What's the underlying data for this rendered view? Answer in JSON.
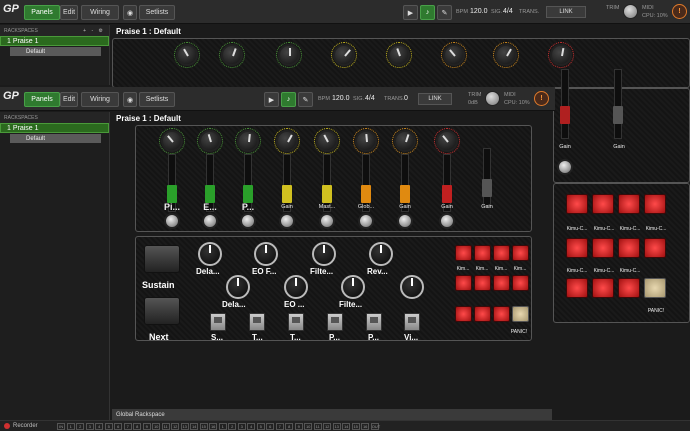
{
  "toolbar": {
    "logo": "GP",
    "tabs": {
      "panels": "Panels",
      "edit": "Edit",
      "wiring": "Wiring",
      "setlists": "Setlists"
    },
    "bpm_label": "BPM",
    "bpm_value": "120.0",
    "sig_label": "SIG.",
    "sig_value": "4/4",
    "trans_label": "TRANS.",
    "trans_value": "0",
    "link_label": "LINK",
    "trim_label": "TRIM",
    "trim_sub": "0dB",
    "midi_label": "MIDI",
    "cpu_label": "CPU:",
    "cpu_value": "10%",
    "panic_symbol": "!"
  },
  "sidebar": {
    "header": "RACKSPACES",
    "controls": "+ - ⚙",
    "rackspace": "1  Praise 1",
    "variation": "Default"
  },
  "rack_title": "Praise 1 : Default",
  "faders": [
    {
      "label": "Pi...",
      "big": true
    },
    {
      "label": "E...",
      "big": true
    },
    {
      "label": "P...",
      "big": true
    },
    {
      "label": "Gain",
      "big": false
    },
    {
      "label": "Mast...",
      "big": false
    },
    {
      "label": "Glob...",
      "big": false
    },
    {
      "label": "Gain",
      "big": false
    },
    {
      "label": "Gain",
      "big": false
    },
    {
      "label": "Gain",
      "big": false
    }
  ],
  "right_faders": [
    {
      "label": "Gain"
    },
    {
      "label": "Gain"
    }
  ],
  "pedals": [
    "Sustain",
    "Next"
  ],
  "knob_row1": [
    "Dela...",
    "EO F...",
    "Filte...",
    "Rev..."
  ],
  "knob_row2": [
    "Dela...",
    "EO ...",
    "Filte...",
    ""
  ],
  "switches": [
    "S...",
    "T...",
    "T...",
    "P...",
    "P...",
    "Vi..."
  ],
  "pads_small": [
    "Kim...",
    "Kim...",
    "Kim...",
    "Kim..."
  ],
  "pads_big": [
    "Kimu-C...",
    "Kimu-C...",
    "Kimu-C...",
    "Kimu-C...",
    "Kimu-C...",
    "Kimu-C...",
    "Kimu-C..."
  ],
  "panic_label": "PANIC!",
  "global_rackspace": "Global Rackspace",
  "status": {
    "recorder": "Recorder",
    "channels": [
      "IN",
      "1",
      "2",
      "3",
      "4",
      "5",
      "6",
      "7",
      "8",
      "9",
      "10",
      "11",
      "12",
      "13",
      "14",
      "15",
      "16",
      "1",
      "2",
      "3",
      "4",
      "5",
      "6",
      "7",
      "8",
      "9",
      "10",
      "11",
      "12",
      "13",
      "14",
      "15",
      "16",
      "OUT"
    ]
  },
  "colors": {
    "accent_green": "#2f7a2f",
    "pad_red": "#ff4a4a",
    "panic_orange": "#e07a2a",
    "knob_rings": [
      "#4c9a3a",
      "#4c9a3a",
      "#4c9a3a",
      "#c8b820",
      "#c8b820",
      "#d89020",
      "#d89020",
      "#d03030"
    ]
  }
}
